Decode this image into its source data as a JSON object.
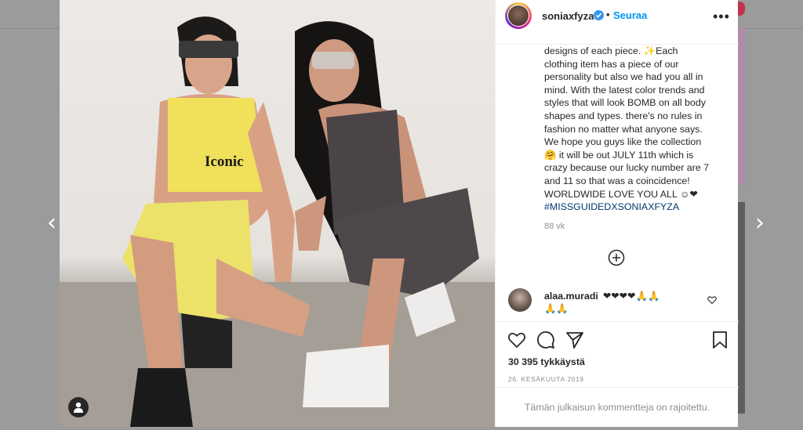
{
  "navigation": {
    "prev_icon": "chevron-left-icon",
    "next_icon": "chevron-right-icon",
    "prev_glyph": "‹",
    "next_glyph": "›"
  },
  "post": {
    "photo": {
      "top_print": "Iconic",
      "icon": "user-tag-icon"
    },
    "header": {
      "username": "soniaxfyza",
      "separator": "•",
      "follow_label": "Seuraa",
      "more_label": "•••",
      "verified_icon": "verified-badge-icon"
    },
    "caption": {
      "lines": [
        "designs of each piece. ✨Each",
        "clothing item has a piece of our",
        "personality but also we had you all in",
        "mind. With the latest color trends and",
        "styles that will look BOMB on all body",
        "shapes and types. there's no rules in",
        "fashion no matter what anyone says.",
        "We hope you guys like the collection",
        "🤗 it will be out JULY 11th which is",
        "crazy because our lucky number are 7",
        "and 11 so that was a coincidence!",
        "WORLDWIDE LOVE YOU ALL ☺❤"
      ],
      "hashtag": "#MISSGUIDEDXSONIAXFYZA",
      "time_ago": "88 vk"
    },
    "load_more_icon": "plus-circle-icon",
    "comment": {
      "username": "alaa.muradi",
      "text_line1": "❤❤❤❤🙏🙏",
      "text_line2": "🙏🙏",
      "like_icon": "heart-outline-icon"
    },
    "actions": {
      "like_icon": "heart-icon",
      "comment_icon": "comment-icon",
      "share_icon": "paper-plane-icon",
      "save_icon": "bookmark-icon"
    },
    "likes": "30 395 tykkäystä",
    "date": "26. KESÄKUUTA 2019",
    "comments_limited": "Tämän julkaisun kommentteja on rajoitettu."
  },
  "colors": {
    "accent": "#0095f6",
    "verified": "#3897f0",
    "text": "#262626",
    "muted": "#8e8e8e",
    "hashtag": "#00376b",
    "overlay": "#9b9b9b"
  }
}
